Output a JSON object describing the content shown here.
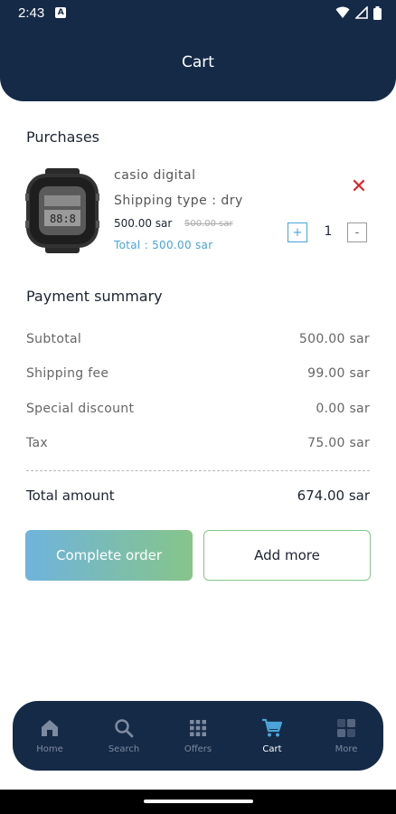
{
  "status": {
    "time": "2:43",
    "notif": "A"
  },
  "header": {
    "title": "Cart"
  },
  "purchases": {
    "title": "Purchases",
    "item": {
      "name": "casio digital",
      "shipping": "Shipping type : dry",
      "price": "500.00 sar",
      "old_price": "500.00 sar",
      "total": "Total : 500.00 sar",
      "quantity": "1",
      "plus": "+",
      "minus": "-",
      "remove": "✕"
    }
  },
  "summary": {
    "title": "Payment summary",
    "rows": [
      {
        "label": "Subtotal",
        "value": "500.00 sar"
      },
      {
        "label": "Shipping fee",
        "value": "99.00 sar"
      },
      {
        "label": "Special discount",
        "value": "0.00 sar"
      },
      {
        "label": "Tax",
        "value": "75.00 sar"
      }
    ],
    "total_label": "Total amount",
    "total_value": "674.00 sar"
  },
  "actions": {
    "complete": "Complete order",
    "add_more": "Add more"
  },
  "nav": [
    {
      "label": "Home",
      "icon": "home-icon",
      "active": false
    },
    {
      "label": "Search",
      "icon": "search-icon",
      "active": false
    },
    {
      "label": "Offers",
      "icon": "grid-icon",
      "active": false
    },
    {
      "label": "Cart",
      "icon": "cart-icon",
      "active": true
    },
    {
      "label": "More",
      "icon": "more-icon",
      "active": false
    }
  ],
  "colors": {
    "navy": "#152a47",
    "accent_blue": "#4aa3d9",
    "accent_green": "#86c58a",
    "remove_red": "#e0242a"
  }
}
